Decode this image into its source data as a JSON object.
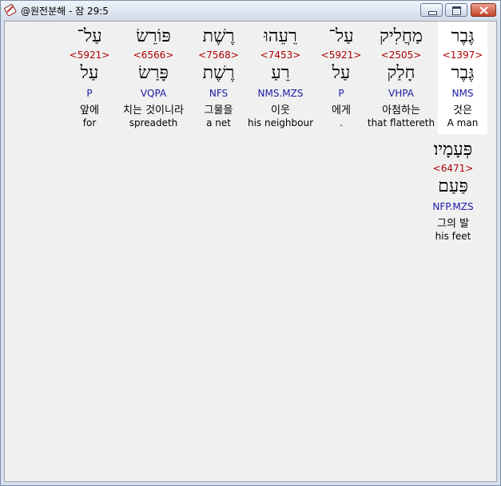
{
  "window": {
    "title": "@원전분해 - 잠 29:5"
  },
  "words": [
    {
      "heb": "גֶּבֶר",
      "strong": "<1397>",
      "lemma": "גֶּבֶר",
      "morph": "NMS",
      "korean": "것은",
      "english": "A man",
      "selected": true
    },
    {
      "heb": "מַחֲלִיק",
      "strong": "<2505>",
      "lemma": "חָלַק",
      "morph": "VHPA",
      "korean": "아첨하는",
      "english": "that flattereth"
    },
    {
      "heb": "עַל־",
      "strong": "<5921>",
      "lemma": "עַל",
      "morph": "P",
      "korean": "에게",
      "english": "."
    },
    {
      "heb": "רֵעֵהוּ",
      "strong": "<7453>",
      "lemma": "רֵעַ",
      "morph": "NMS.MZS",
      "korean": "이웃",
      "english": "his neighbour"
    },
    {
      "heb": "רֶשֶׁת",
      "strong": "<7568>",
      "lemma": "רֶשֶׁת",
      "morph": "NFS",
      "korean": "그물을",
      "english": "a net"
    },
    {
      "heb": "פּוֹרֵשׂ",
      "strong": "<6566>",
      "lemma": "פָּרַשׂ",
      "morph": "VQPA",
      "korean": "치는 것이니라",
      "english": "spreadeth"
    },
    {
      "heb": "עַל־",
      "strong": "<5921>",
      "lemma": "עַל",
      "morph": "P",
      "korean": "앞에",
      "english": "for"
    },
    {
      "heb": "פְּעָמָיו׃",
      "strong": "<6471>",
      "lemma": "פַּעַם",
      "morph": "NFP.MZS",
      "korean": "그의 발",
      "english": "his feet"
    }
  ]
}
